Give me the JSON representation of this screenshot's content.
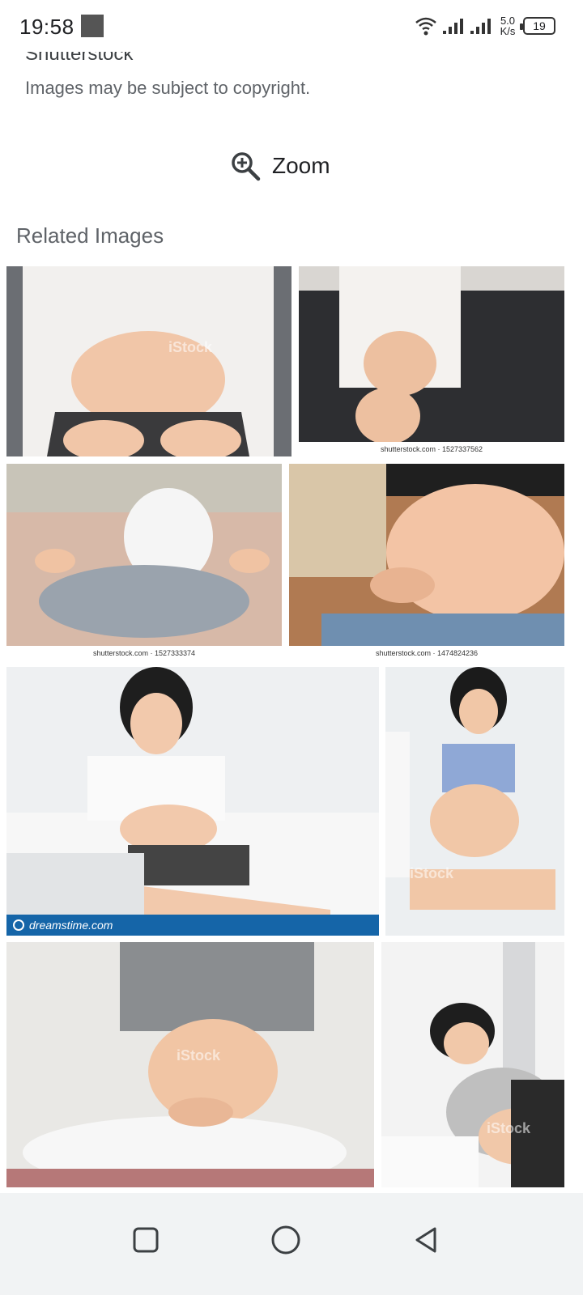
{
  "status_bar": {
    "time": "19:58",
    "net_speed_value": "5.0",
    "net_speed_unit": "K/s",
    "battery": "19"
  },
  "source": {
    "title": "Shutterstock",
    "copyright_notice": "Images may be subject to copyright."
  },
  "zoom": {
    "label": "Zoom",
    "icon": "zoom-in-icon"
  },
  "related": {
    "title": "Related Images",
    "images": [
      {
        "name": "related-image-1",
        "watermark": "iStock"
      },
      {
        "name": "related-image-2",
        "caption": "shutterstock.com · 1527337562"
      },
      {
        "name": "related-image-3",
        "caption": "shutterstock.com · 1527333374"
      },
      {
        "name": "related-image-4",
        "caption": "shutterstock.com · 1474824236"
      },
      {
        "name": "related-image-5",
        "brand": "dreamstime.com"
      },
      {
        "name": "related-image-6",
        "watermark": "iStock"
      },
      {
        "name": "related-image-7",
        "watermark": "iStock"
      },
      {
        "name": "related-image-8",
        "watermark": "iStock"
      }
    ]
  },
  "nav": {
    "recents_icon": "square-icon",
    "home_icon": "circle-icon",
    "back_icon": "triangle-back-icon"
  }
}
